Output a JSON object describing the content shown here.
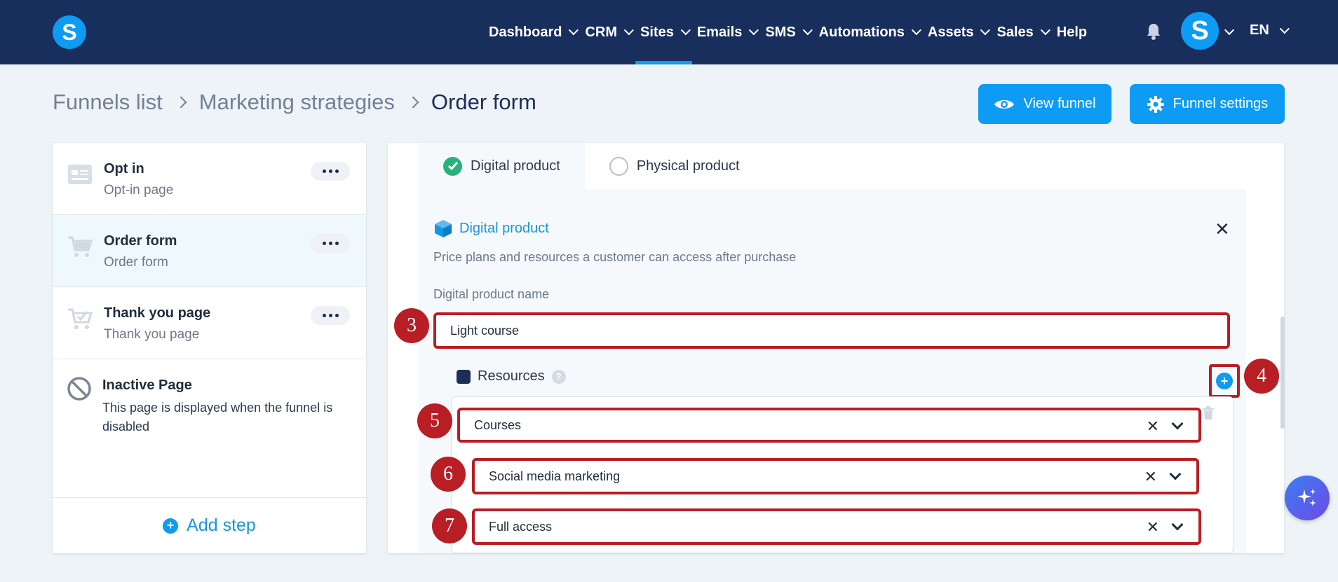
{
  "header": {
    "logo_letter": "S",
    "nav": [
      {
        "label": "Dashboard",
        "has_chevron": true
      },
      {
        "label": "CRM",
        "has_chevron": true
      },
      {
        "label": "Sites",
        "has_chevron": true,
        "active": true
      },
      {
        "label": "Emails",
        "has_chevron": true
      },
      {
        "label": "SMS",
        "has_chevron": true
      },
      {
        "label": "Automations",
        "has_chevron": true
      },
      {
        "label": "Assets",
        "has_chevron": true
      },
      {
        "label": "Sales",
        "has_chevron": true
      },
      {
        "label": "Help",
        "has_chevron": false
      }
    ],
    "bell_icon": "bell-icon",
    "avatar_letter": "S",
    "language": "EN",
    "accent_color": "#0d9bf3",
    "bg_color": "#182e5c"
  },
  "breadcrumb": {
    "items": [
      "Funnels list",
      "Marketing strategies"
    ],
    "current": "Order form"
  },
  "actions": {
    "view_funnel": "View funnel",
    "funnel_settings": "Funnel settings"
  },
  "steps": [
    {
      "title": "Opt in",
      "subtitle": "Opt-in page",
      "icon": "page-icon"
    },
    {
      "title": "Order form",
      "subtitle": "Order form",
      "icon": "cart-icon",
      "active": true
    },
    {
      "title": "Thank you page",
      "subtitle": "Thank you page",
      "icon": "cart-check-icon"
    }
  ],
  "inactive_page": {
    "title": "Inactive Page",
    "description": "This page is displayed when the funnel is disabled"
  },
  "add_step_label": "Add step",
  "product_tabs": [
    {
      "label": "Digital product",
      "selected": true
    },
    {
      "label": "Physical product",
      "selected": false
    }
  ],
  "digital_product": {
    "title": "Digital product",
    "description": "Price plans and resources a customer can access after purchase",
    "name_label": "Digital product name",
    "name_value": "Light course",
    "resources_label": "Resources",
    "resource_type": "Courses",
    "course": "Social media marketing",
    "access": "Full access"
  },
  "markers": [
    "3",
    "4",
    "5",
    "6",
    "7"
  ],
  "annotation_color": "#b81e24"
}
